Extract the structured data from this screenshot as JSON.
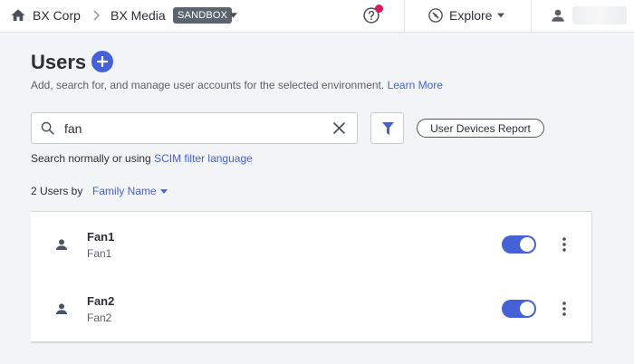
{
  "topbar": {
    "org": "BX Corp",
    "environment": "BX Media",
    "env_badge": "SANDBOX",
    "explore_label": "Explore"
  },
  "page": {
    "title": "Users",
    "subtitle": "Add, search for, and manage user accounts for the selected environment.",
    "learn_more": "Learn More"
  },
  "search": {
    "value": "fan",
    "placeholder": "Search",
    "hint_prefix": "Search normally or using",
    "hint_link": "SCIM filter language"
  },
  "toolbar": {
    "report_label": "User Devices Report"
  },
  "results": {
    "count_label": "2 Users by",
    "sort_label": "Family Name"
  },
  "users": [
    {
      "name": "Fan1",
      "sub": "Fan1",
      "enabled": true
    },
    {
      "name": "Fan2",
      "sub": "Fan2",
      "enabled": true
    }
  ],
  "colors": {
    "accent": "#4462d6",
    "notification": "#e2165f",
    "badge_bg": "#5c6470"
  }
}
